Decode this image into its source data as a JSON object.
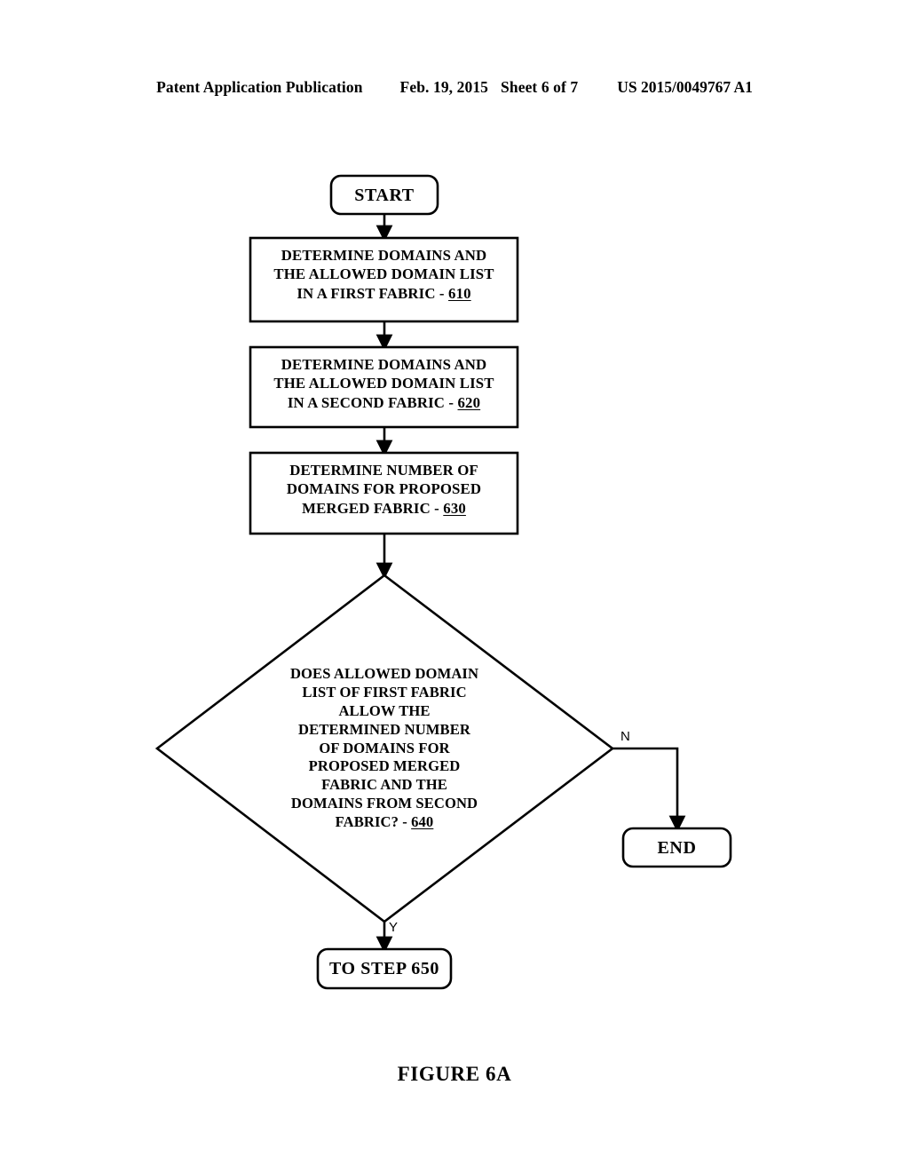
{
  "header": {
    "publication": "Patent Application Publication",
    "date": "Feb. 19, 2015",
    "sheet": "Sheet 6 of 7",
    "document_number": "US 2015/0049767 A1"
  },
  "caption": "FIGURE 6A",
  "colors": {
    "background": "#ffffff",
    "ink": "#000000",
    "stroke": "#000000"
  },
  "flowchart": {
    "start": {
      "label": "START",
      "shape": "rounded-rectangle"
    },
    "step_610": {
      "line1": "DETERMINE DOMAINS AND",
      "line2": "THE ALLOWED DOMAIN LIST",
      "line3_prefix": "IN A FIRST FABRIC - ",
      "number": "610",
      "shape": "rectangle"
    },
    "step_620": {
      "line1": "DETERMINE DOMAINS AND",
      "line2": "THE ALLOWED DOMAIN LIST",
      "line3_prefix": "IN A SECOND FABRIC - ",
      "number": "620",
      "shape": "rectangle"
    },
    "step_630": {
      "line1": "DETERMINE NUMBER OF",
      "line2": "DOMAINS FOR PROPOSED",
      "line3_prefix": "MERGED FABRIC - ",
      "number": "630",
      "shape": "rectangle"
    },
    "decision_640": {
      "line1": "DOES ALLOWED DOMAIN",
      "line2": "LIST OF FIRST FABRIC",
      "line3": "ALLOW THE",
      "line4": "DETERMINED NUMBER",
      "line5": "OF DOMAINS FOR",
      "line6": "PROPOSED MERGED",
      "line7": "FABRIC AND THE",
      "line8": "DOMAINS FROM SECOND",
      "line9_prefix": "FABRIC? - ",
      "number": "640",
      "shape": "diamond"
    },
    "end": {
      "label": "END",
      "shape": "rounded-rectangle"
    },
    "to_step_650": {
      "label": "TO STEP 650",
      "shape": "rounded-rectangle"
    },
    "branch_no": "N",
    "branch_yes": "Y"
  }
}
